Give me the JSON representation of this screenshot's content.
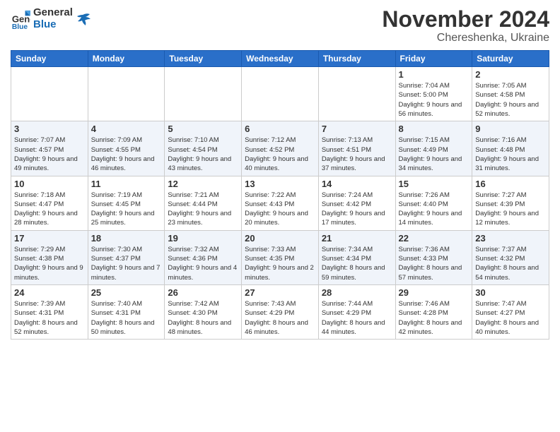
{
  "logo": {
    "general": "General",
    "blue": "Blue"
  },
  "title": "November 2024",
  "location": "Chereshenka, Ukraine",
  "days_header": [
    "Sunday",
    "Monday",
    "Tuesday",
    "Wednesday",
    "Thursday",
    "Friday",
    "Saturday"
  ],
  "weeks": [
    [
      {
        "day": "",
        "info": ""
      },
      {
        "day": "",
        "info": ""
      },
      {
        "day": "",
        "info": ""
      },
      {
        "day": "",
        "info": ""
      },
      {
        "day": "",
        "info": ""
      },
      {
        "day": "1",
        "info": "Sunrise: 7:04 AM\nSunset: 5:00 PM\nDaylight: 9 hours and 56 minutes."
      },
      {
        "day": "2",
        "info": "Sunrise: 7:05 AM\nSunset: 4:58 PM\nDaylight: 9 hours and 52 minutes."
      }
    ],
    [
      {
        "day": "3",
        "info": "Sunrise: 7:07 AM\nSunset: 4:57 PM\nDaylight: 9 hours and 49 minutes."
      },
      {
        "day": "4",
        "info": "Sunrise: 7:09 AM\nSunset: 4:55 PM\nDaylight: 9 hours and 46 minutes."
      },
      {
        "day": "5",
        "info": "Sunrise: 7:10 AM\nSunset: 4:54 PM\nDaylight: 9 hours and 43 minutes."
      },
      {
        "day": "6",
        "info": "Sunrise: 7:12 AM\nSunset: 4:52 PM\nDaylight: 9 hours and 40 minutes."
      },
      {
        "day": "7",
        "info": "Sunrise: 7:13 AM\nSunset: 4:51 PM\nDaylight: 9 hours and 37 minutes."
      },
      {
        "day": "8",
        "info": "Sunrise: 7:15 AM\nSunset: 4:49 PM\nDaylight: 9 hours and 34 minutes."
      },
      {
        "day": "9",
        "info": "Sunrise: 7:16 AM\nSunset: 4:48 PM\nDaylight: 9 hours and 31 minutes."
      }
    ],
    [
      {
        "day": "10",
        "info": "Sunrise: 7:18 AM\nSunset: 4:47 PM\nDaylight: 9 hours and 28 minutes."
      },
      {
        "day": "11",
        "info": "Sunrise: 7:19 AM\nSunset: 4:45 PM\nDaylight: 9 hours and 25 minutes."
      },
      {
        "day": "12",
        "info": "Sunrise: 7:21 AM\nSunset: 4:44 PM\nDaylight: 9 hours and 23 minutes."
      },
      {
        "day": "13",
        "info": "Sunrise: 7:22 AM\nSunset: 4:43 PM\nDaylight: 9 hours and 20 minutes."
      },
      {
        "day": "14",
        "info": "Sunrise: 7:24 AM\nSunset: 4:42 PM\nDaylight: 9 hours and 17 minutes."
      },
      {
        "day": "15",
        "info": "Sunrise: 7:26 AM\nSunset: 4:40 PM\nDaylight: 9 hours and 14 minutes."
      },
      {
        "day": "16",
        "info": "Sunrise: 7:27 AM\nSunset: 4:39 PM\nDaylight: 9 hours and 12 minutes."
      }
    ],
    [
      {
        "day": "17",
        "info": "Sunrise: 7:29 AM\nSunset: 4:38 PM\nDaylight: 9 hours and 9 minutes."
      },
      {
        "day": "18",
        "info": "Sunrise: 7:30 AM\nSunset: 4:37 PM\nDaylight: 9 hours and 7 minutes."
      },
      {
        "day": "19",
        "info": "Sunrise: 7:32 AM\nSunset: 4:36 PM\nDaylight: 9 hours and 4 minutes."
      },
      {
        "day": "20",
        "info": "Sunrise: 7:33 AM\nSunset: 4:35 PM\nDaylight: 9 hours and 2 minutes."
      },
      {
        "day": "21",
        "info": "Sunrise: 7:34 AM\nSunset: 4:34 PM\nDaylight: 8 hours and 59 minutes."
      },
      {
        "day": "22",
        "info": "Sunrise: 7:36 AM\nSunset: 4:33 PM\nDaylight: 8 hours and 57 minutes."
      },
      {
        "day": "23",
        "info": "Sunrise: 7:37 AM\nSunset: 4:32 PM\nDaylight: 8 hours and 54 minutes."
      }
    ],
    [
      {
        "day": "24",
        "info": "Sunrise: 7:39 AM\nSunset: 4:31 PM\nDaylight: 8 hours and 52 minutes."
      },
      {
        "day": "25",
        "info": "Sunrise: 7:40 AM\nSunset: 4:31 PM\nDaylight: 8 hours and 50 minutes."
      },
      {
        "day": "26",
        "info": "Sunrise: 7:42 AM\nSunset: 4:30 PM\nDaylight: 8 hours and 48 minutes."
      },
      {
        "day": "27",
        "info": "Sunrise: 7:43 AM\nSunset: 4:29 PM\nDaylight: 8 hours and 46 minutes."
      },
      {
        "day": "28",
        "info": "Sunrise: 7:44 AM\nSunset: 4:29 PM\nDaylight: 8 hours and 44 minutes."
      },
      {
        "day": "29",
        "info": "Sunrise: 7:46 AM\nSunset: 4:28 PM\nDaylight: 8 hours and 42 minutes."
      },
      {
        "day": "30",
        "info": "Sunrise: 7:47 AM\nSunset: 4:27 PM\nDaylight: 8 hours and 40 minutes."
      }
    ]
  ]
}
